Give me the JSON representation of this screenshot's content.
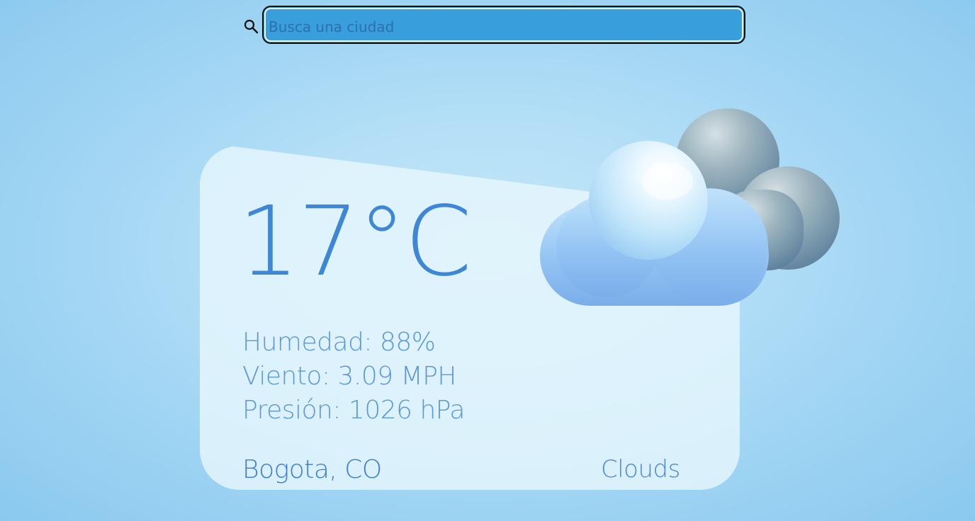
{
  "search": {
    "placeholder": "Busca una ciudad",
    "value": "",
    "icon": "search-icon"
  },
  "weather": {
    "temperature": "17°C",
    "details": [
      {
        "label": "Humedad:",
        "value": "88%"
      },
      {
        "label": "Viento:",
        "value": "3.09 MPH"
      },
      {
        "label": "Presión:",
        "value": "1026 hPa"
      }
    ],
    "location": "Bogota, CO",
    "condition": "Clouds",
    "icon": "clouds-icon"
  },
  "colors": {
    "search_fill": "#389fdc",
    "text_accent": "#3d87d6",
    "background": "#9fd4f3"
  }
}
